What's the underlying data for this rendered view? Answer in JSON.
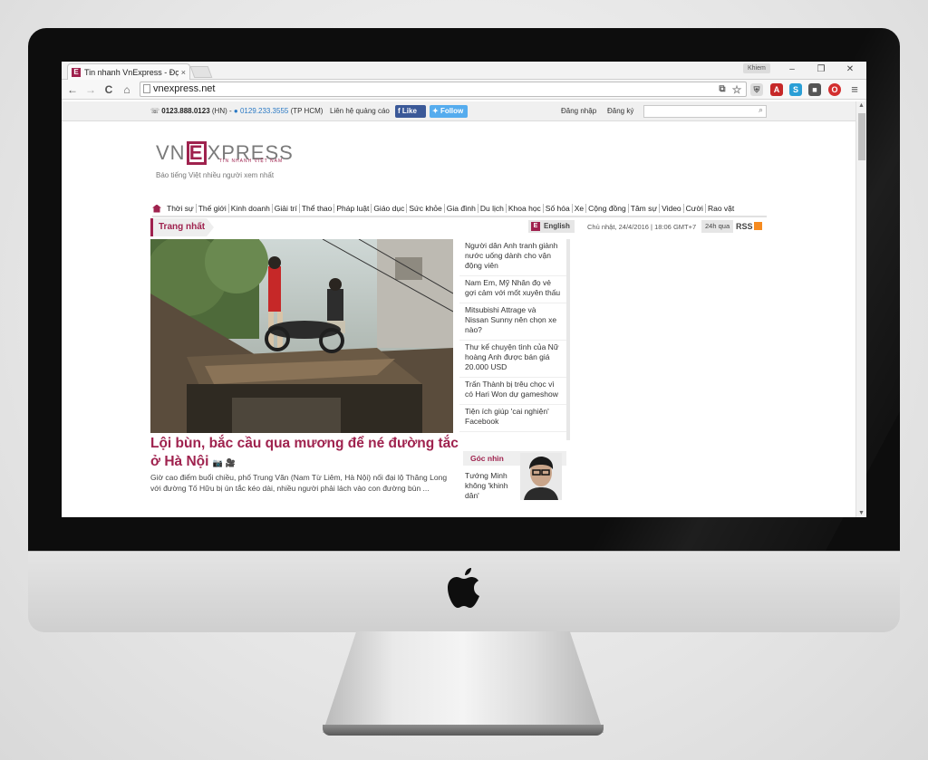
{
  "browser": {
    "tab_title": "Tin nhanh VnExpress - Đọ",
    "tab_close": "×",
    "profile": "Khiem",
    "url": "vnexpress.net",
    "minimize": "–",
    "maximize": "❐",
    "close": "✕",
    "back": "←",
    "forward": "→",
    "reload": "C",
    "home": "⌂",
    "menu": "≡"
  },
  "topbar": {
    "phone_hn": "0123.888.0123",
    "phone_hn_suffix": "(HN) -",
    "phone_hcm": "0129.233.3555",
    "phone_hcm_suffix": "(TP HCM)",
    "ad_contact": "Liên hệ quảng cáo",
    "fb_like": "Like",
    "tw_follow": "Follow",
    "login": "Đăng nhập",
    "register": "Đăng ký"
  },
  "site": {
    "logo_pre": "VN",
    "logo_e": "E",
    "logo_post": "XPRESS",
    "logo_sub": "TIN NHANH VIỆT NAM",
    "slogan": "Báo tiếng Việt nhiều người xem nhất"
  },
  "menu": [
    "Thời sự",
    "Thế giới",
    "Kinh doanh",
    "Giải trí",
    "Thể thao",
    "Pháp luật",
    "Giáo dục",
    "Sức khỏe",
    "Gia đình",
    "Du lịch",
    "Khoa học",
    "Số hóa",
    "Xe",
    "Cộng đồng",
    "Tâm sự",
    "Video",
    "Cười",
    "Rao vặt"
  ],
  "section": {
    "tag": "Trang nhất",
    "english": "English",
    "date": "Chủ nhật, 24/4/2016 | 18:06 GMT+7",
    "h24": "24h qua",
    "rss": "RSS"
  },
  "hero": {
    "title": "Lội bùn, bắc cầu qua mương để né đường tắc ở Hà Nội",
    "media_icons": "📷 🎥",
    "lead": "Giờ cao điểm buổi chiều, phố Trung Văn (Nam Từ Liêm, Hà Nội) nối đại lộ Thăng Long với đường Tố Hữu bị ùn tắc kéo dài, nhiều người phải lách vào con đường bùn ..."
  },
  "side_news": [
    "Người dân Anh tranh giành nước uống dành cho vận động viên",
    "Nam Em, Mỹ Nhân đọ vẻ gợi cảm với mốt xuyên thấu",
    "Mitsubishi Attrage và Nissan Sunny nên chọn xe nào?",
    "Thư kể chuyện tình của Nữ hoàng Anh được bán giá 20.000 USD",
    "Trấn Thành bị trêu chọc vì có Hari Won dự gameshow",
    "Tiện ích giúp 'cai nghiện' Facebook"
  ],
  "goc_nhin": {
    "label": "Góc nhìn",
    "text": "Tướng Minh không 'khinh dân'"
  },
  "colors": {
    "brand": "#9f224e",
    "facebook": "#3b5998",
    "twitter": "#55acee",
    "skype": "#2a79c4"
  }
}
